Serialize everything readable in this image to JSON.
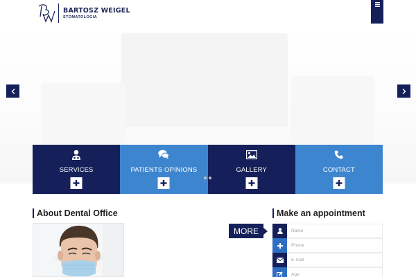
{
  "header": {
    "brand_name": "BARTOSZ WEIGEL",
    "brand_sub": "STOMATOLOGIA",
    "logo_monogram": "BW",
    "menu_icon": "hamburger-icon"
  },
  "slider": {
    "prev_icon": "chevron-left-icon",
    "next_icon": "chevron-right-icon"
  },
  "tiles": [
    {
      "label": "SERVICES",
      "icon": "doctor-icon",
      "style": "dark"
    },
    {
      "label": "PATIENTS OPINIONS",
      "icon": "chat-bubbles-icon",
      "style": "light"
    },
    {
      "label": "GALLERY",
      "icon": "image-icon",
      "style": "dark"
    },
    {
      "label": "CONTACT",
      "icon": "phone-icon",
      "style": "light"
    }
  ],
  "about": {
    "title": "About Dental Office",
    "more_label": "MORE"
  },
  "appointment": {
    "title": "Make an appointment",
    "fields": [
      {
        "placeholder": "Name",
        "icon": "user-icon"
      },
      {
        "placeholder": "Phone",
        "icon": "plus-icon"
      },
      {
        "placeholder": "E-mail",
        "icon": "envelope-icon"
      },
      {
        "placeholder": "Age",
        "icon": "edit-icon"
      }
    ]
  },
  "colors": {
    "navy": "#15205a",
    "blue": "#3d86cf"
  }
}
